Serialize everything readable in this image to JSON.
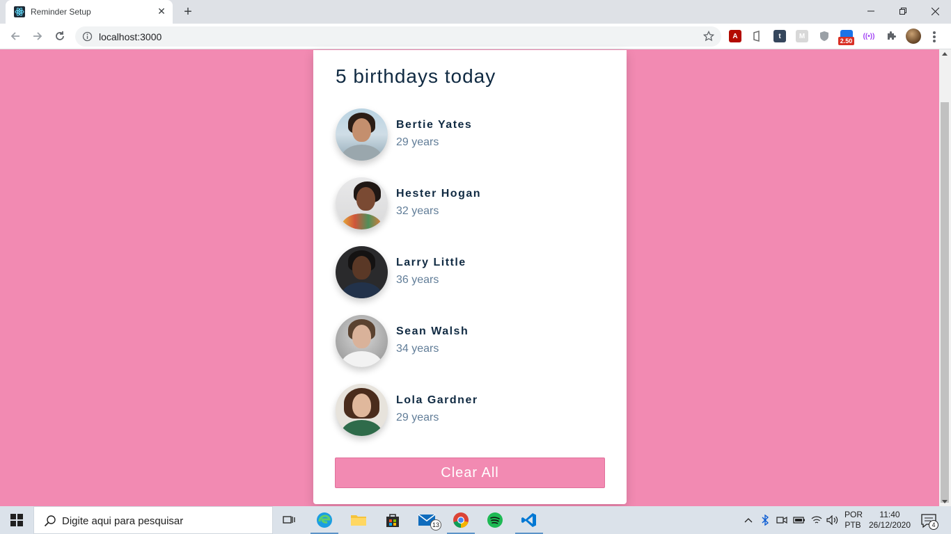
{
  "browser": {
    "tab_title": "Reminder Setup",
    "tab_close": "✕",
    "new_tab": "+",
    "url": "localhost:3000",
    "extension_badge": "2.50"
  },
  "app": {
    "title": "5 birthdays today",
    "people": [
      {
        "name": "Bertie Yates",
        "age": "29 years"
      },
      {
        "name": "Hester Hogan",
        "age": "32 years"
      },
      {
        "name": "Larry Little",
        "age": "36 years"
      },
      {
        "name": "Sean Walsh",
        "age": "34 years"
      },
      {
        "name": "Lola Gardner",
        "age": "29 years"
      }
    ],
    "clear_button": "Clear All"
  },
  "taskbar": {
    "search_placeholder": "Digite aqui para pesquisar",
    "mail_count": "13",
    "lang_top": "POR",
    "lang_bottom": "PTB",
    "time": "11:40",
    "date": "26/12/2020",
    "notification_count": "4"
  },
  "colors": {
    "page_background": "#f28ab2",
    "title": "#102a42",
    "age": "#617d98"
  }
}
